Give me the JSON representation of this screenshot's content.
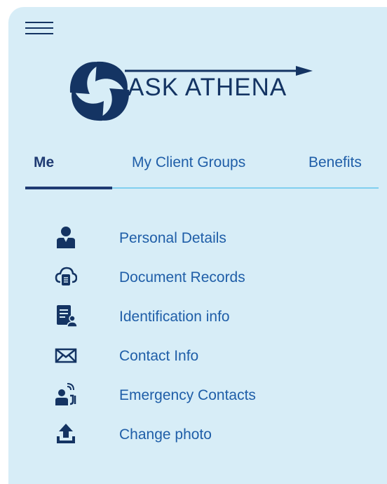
{
  "brand": {
    "name": "ASK ATHENA"
  },
  "colors": {
    "panel_bg": "#d7edf7",
    "navy": "#143463",
    "link": "#1f5ea8",
    "tab_line": "#80cfef"
  },
  "tabs": [
    {
      "label": "Me",
      "active": true
    },
    {
      "label": "My Client Groups",
      "active": false
    },
    {
      "label": "Benefits",
      "active": false
    }
  ],
  "menu": {
    "items": [
      {
        "label": "Personal Details",
        "icon": "person-icon"
      },
      {
        "label": "Document Records",
        "icon": "cloud-document-icon"
      },
      {
        "label": "Identification info",
        "icon": "id-document-icon"
      },
      {
        "label": "Contact Info",
        "icon": "envelope-icon"
      },
      {
        "label": "Emergency Contacts",
        "icon": "emergency-contact-icon"
      },
      {
        "label": "Change photo",
        "icon": "upload-icon"
      }
    ]
  }
}
